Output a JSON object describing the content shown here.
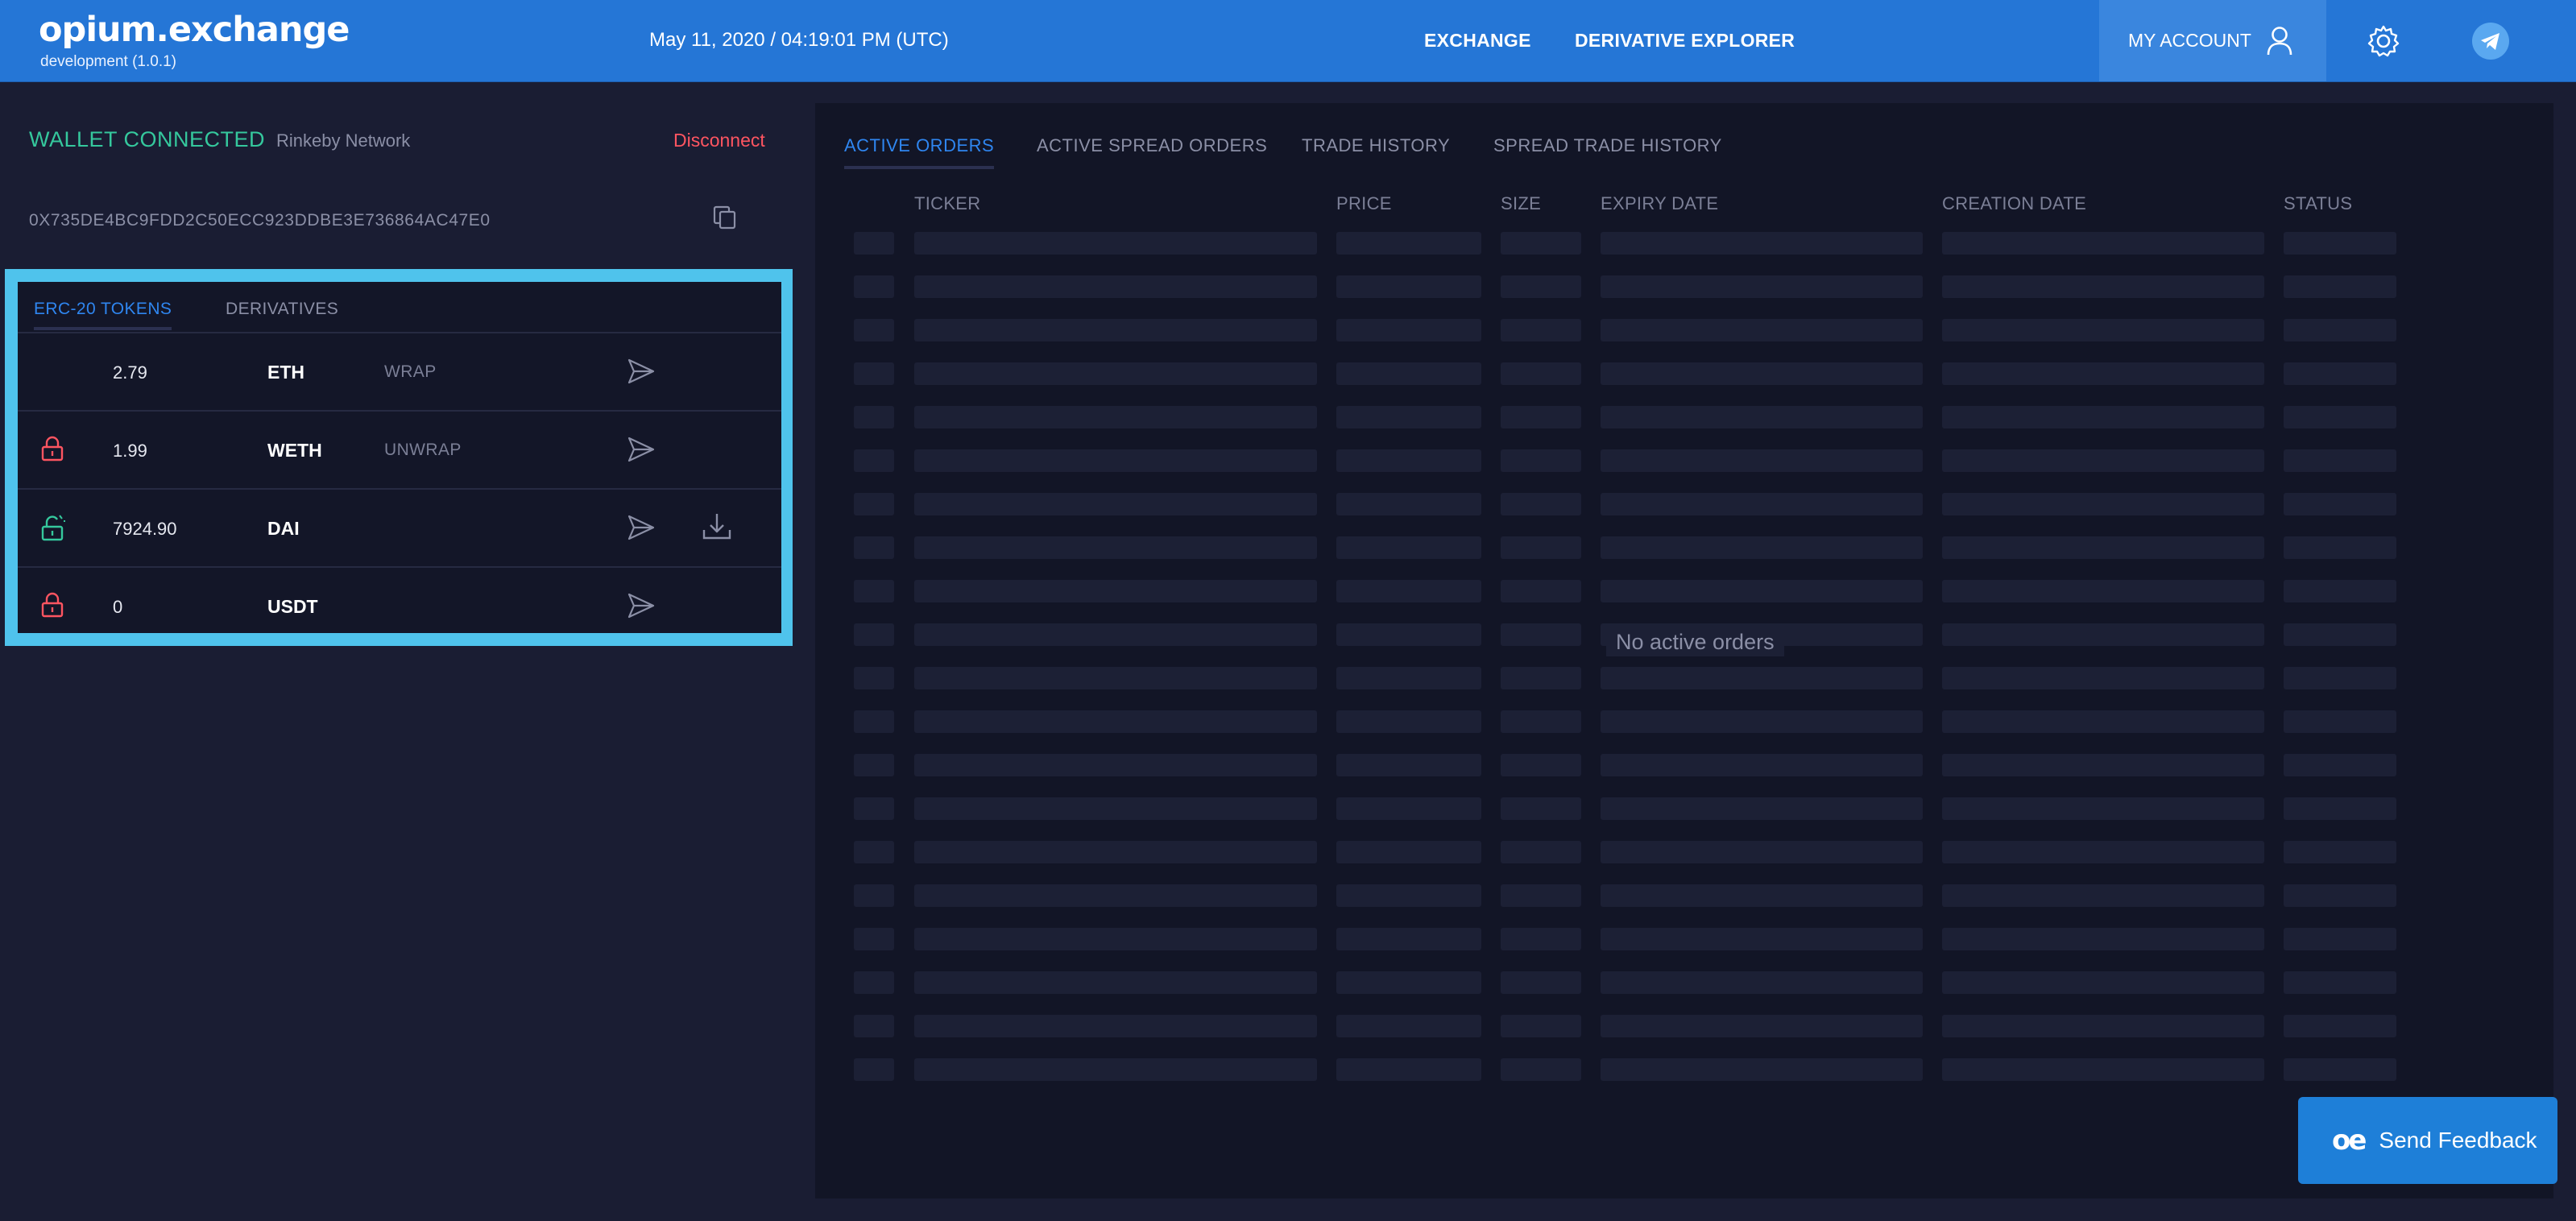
{
  "header": {
    "logo": "opium.exchange",
    "version": "development (1.0.1)",
    "datetime": "May 11, 2020 / 04:19:01 PM (UTC)",
    "nav": [
      {
        "label": "EXCHANGE"
      },
      {
        "label": "DERIVATIVE EXPLORER"
      }
    ],
    "account_label": "MY ACCOUNT",
    "icons": {
      "account": "user-icon",
      "settings": "gear-icon",
      "telegram": "telegram-icon"
    }
  },
  "wallet": {
    "status": "WALLET CONNECTED",
    "network": "Rinkeby Network",
    "disconnect": "Disconnect",
    "address": "0X735DE4BC9FDD2C50ECC923DDBE3E736864AC47E0"
  },
  "tokens": {
    "tabs": [
      "ERC-20 TOKENS",
      "DERIVATIVES"
    ],
    "rows": [
      {
        "amount": "2.79",
        "symbol": "ETH",
        "action": "WRAP",
        "lock": "none",
        "download": false
      },
      {
        "amount": "1.99",
        "symbol": "WETH",
        "action": "UNWRAP",
        "lock": "locked",
        "download": false
      },
      {
        "amount": "7924.90",
        "symbol": "DAI",
        "action": "",
        "lock": "unlocked",
        "download": true
      },
      {
        "amount": "0",
        "symbol": "USDT",
        "action": "",
        "lock": "locked",
        "download": false
      }
    ]
  },
  "orders": {
    "tabs": [
      "ACTIVE ORDERS",
      "ACTIVE SPREAD ORDERS",
      "TRADE HISTORY",
      "SPREAD TRADE HISTORY"
    ],
    "columns": [
      "TICKER",
      "PRICE",
      "SIZE",
      "EXPIRY DATE",
      "CREATION DATE",
      "STATUS"
    ],
    "empty_message": "No active orders"
  },
  "feedback": {
    "logo": "oe",
    "label": "Send Feedback"
  },
  "colors": {
    "header": "#2576d6",
    "accent": "#2f86f0",
    "connected": "#35c89d",
    "danger": "#ff5561",
    "highlight": "#4fc3ec"
  }
}
